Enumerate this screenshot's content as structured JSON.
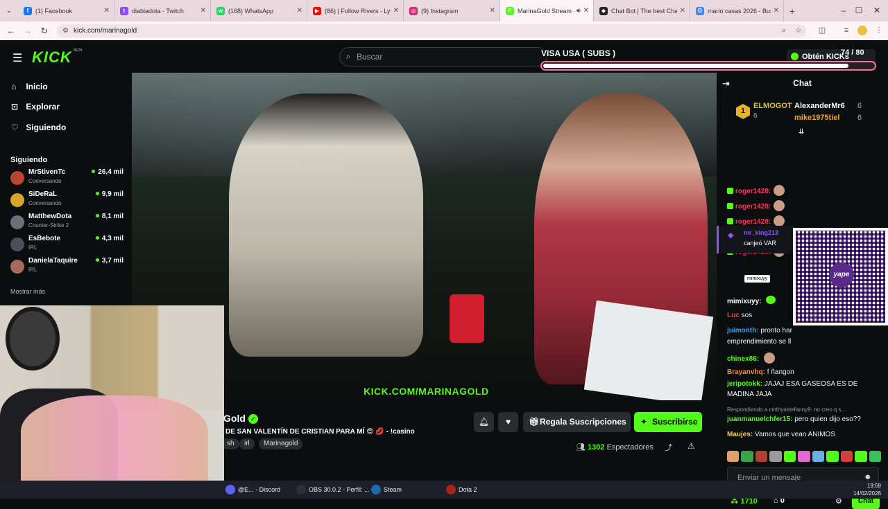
{
  "browser": {
    "tabs": [
      {
        "title": "(1) Facebook",
        "icon": "facebook-icon",
        "color": "#1877f2",
        "glyph": "f"
      },
      {
        "title": "diabladota - Twitch",
        "icon": "twitch-icon",
        "color": "#9146ff",
        "glyph": "t"
      },
      {
        "title": "(168) WhatsApp",
        "icon": "whatsapp-icon",
        "color": "#25d366",
        "glyph": "w"
      },
      {
        "title": "(86) | Follow Rivers - Lykk",
        "icon": "youtube-icon",
        "color": "#ff0000",
        "glyph": "▶"
      },
      {
        "title": "(9) Instagram",
        "icon": "instagram-icon",
        "color": "#d62976",
        "glyph": "◎"
      },
      {
        "title": "MarinaGold Stream -",
        "icon": "kick-icon",
        "color": "#53fc18",
        "glyph": "K"
      },
      {
        "title": "Chat Bot | The best ChatB",
        "icon": "chatbot-icon",
        "color": "#222222",
        "glyph": "◆"
      },
      {
        "title": "mario casas 2026 - Busca",
        "icon": "google-icon",
        "color": "#4285f4",
        "glyph": "G"
      }
    ],
    "url": "kick.com/marinagold"
  },
  "header": {
    "logo": "KICK",
    "beta": "BETA",
    "search_placeholder": "Buscar",
    "kicks_label": "Obtén KICKs"
  },
  "overlay": {
    "subs_label": "VISA USA ( SUBS )",
    "subs_count": "74 / 80",
    "subs_progress": 0.925
  },
  "sidebar": {
    "nav": [
      {
        "label": "Inicio",
        "icon": "home-icon",
        "glyph": "⌂"
      },
      {
        "label": "Explorar",
        "icon": "compass-icon",
        "glyph": "⊡"
      },
      {
        "label": "Siguiendo",
        "icon": "heart-icon",
        "glyph": "♡"
      }
    ],
    "following_title": "Siguiendo",
    "following": [
      {
        "name": "MrStivenTc",
        "category": "Conversando",
        "viewers": "26,4 mil",
        "color": "#b8462f"
      },
      {
        "name": "SiDeRaL",
        "category": "Conversando",
        "viewers": "9,9 mil",
        "color": "#d9a32b"
      },
      {
        "name": "MatthewDota",
        "category": "Counter-Strike 2",
        "viewers": "8,1 mil",
        "color": "#6b6f7a"
      },
      {
        "name": "EsBebote",
        "category": "IRL",
        "viewers": "4,3 mil",
        "color": "#4a4f5a"
      },
      {
        "name": "DanielaTaquire",
        "category": "IRL",
        "viewers": "3,7 mil",
        "color": "#a86a5c"
      }
    ],
    "show_more": "Mostrar más"
  },
  "stream": {
    "watermark": "KICK.COM/MARINAGOLD",
    "title": "Gold",
    "subtitle": "DE SAN VALENTÍN DE CRISTIAN PARA MÍ 😍 💋 - !casino",
    "tags": [
      "sh",
      "irl",
      "Marinagold"
    ],
    "gift_label": "Regala Suscripciones",
    "subscribe_label": "Suscribirse",
    "viewers_count": "1302",
    "viewers_label": "Espectadores"
  },
  "chat": {
    "title": "Chat",
    "top_gifter_rank": "1",
    "top_gifters": [
      {
        "name": "ELMOGOT",
        "count": "6"
      },
      {
        "name": "AlexanderMr6",
        "count": "6",
        "color": "#ffffff"
      },
      {
        "name": "mike1975tiel",
        "count": "6",
        "color": "#f5a623"
      }
    ],
    "repeat_user": "roger1428:",
    "redeem_user": "mr_king213",
    "redeem_text": "canjeó VAR",
    "messages": [
      {
        "user": "mimixuyy:",
        "text": "",
        "color": "#ffffff"
      },
      {
        "user": "Luc",
        "text": "sos",
        "color": "#ff3b3b"
      },
      {
        "user": "juimonth:",
        "text": "pronto har",
        "color": "#2da7ff"
      },
      {
        "user": "",
        "text": "emprendimiento se ll",
        "color": "#ffffff"
      },
      {
        "user": "chinex86:",
        "text": "",
        "color": "#53fc18"
      },
      {
        "user": "Brayanvhq:",
        "text": "f ñangon",
        "color": "#ff8a3b"
      },
      {
        "user": "jeripotokk:",
        "text": "JAJAJ ESA GASEOSA ES DE",
        "color": "#53fc18"
      },
      {
        "user": "",
        "text": "MADINA JAJA",
        "color": "#ffffff"
      },
      {
        "user": "",
        "text": "Respondiendo a cinthyastefanny9: no creo q s...",
        "color": "#999999"
      },
      {
        "user": "juanmanuelchfer15:",
        "text": "pero quien dijo eso??",
        "color": "#53fc18"
      },
      {
        "user": "Maujes:",
        "text": "Vamos que vean ANIMOS",
        "color": "#ffcf3b"
      }
    ],
    "tooltip": "mimixuyy",
    "qr_brand": "yape",
    "input_placeholder": "Enviar un mensaje",
    "points": "1710",
    "points_other": "0",
    "send_label": "Chat"
  },
  "taskbar": {
    "items": [
      {
        "label": "@E... - Discord",
        "icon": "discord-icon",
        "color": "#5865f2"
      },
      {
        "label": "OBS 30.0.2 - Perfil: ...",
        "icon": "obs-icon",
        "color": "#302e31"
      },
      {
        "label": "Steam",
        "icon": "steam-icon",
        "color": "#1b6ba8"
      },
      {
        "label": "Dota 2",
        "icon": "dota-icon",
        "color": "#a8231a"
      }
    ],
    "time": "19:59",
    "date": "14/02/2026"
  }
}
